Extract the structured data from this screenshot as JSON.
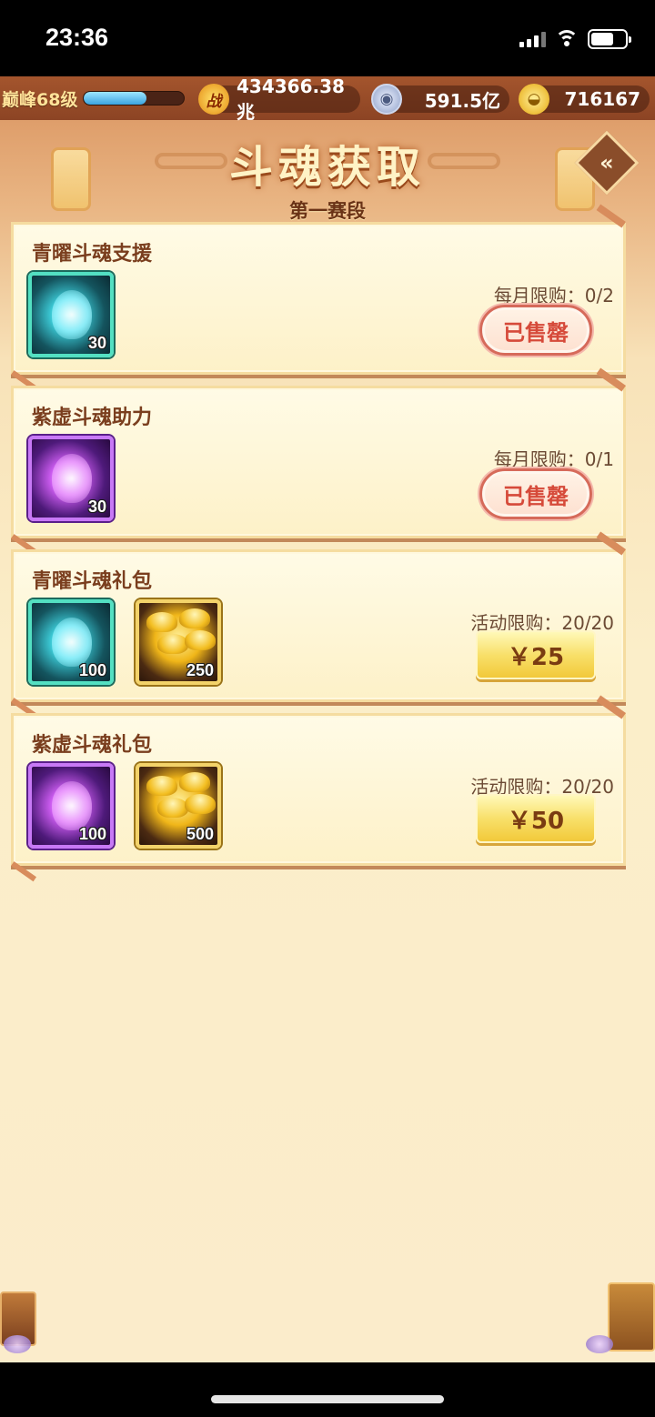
{
  "status_bar": {
    "time": "23:36"
  },
  "resources": {
    "level": "巅峰68级",
    "xp_fill": 0.62,
    "power_icon_text": "战",
    "power": "434366.38兆",
    "coins": "591.5亿",
    "ingots": "716167"
  },
  "header": {
    "title": "斗魂获取",
    "subtitle": "第一赛段",
    "back_icon": "double-chevron-left-icon"
  },
  "packs": [
    {
      "name": "青曜斗魂支援",
      "items": [
        {
          "type": "cyan-soul",
          "qty": "30"
        }
      ],
      "limit_label": "每月限购：0/2",
      "button": "已售罄",
      "sold_out": true
    },
    {
      "name": "紫虚斗魂助力",
      "items": [
        {
          "type": "purple-soul",
          "qty": "30"
        }
      ],
      "limit_label": "每月限购：0/1",
      "button": "已售罄",
      "sold_out": true
    },
    {
      "name": "青曜斗魂礼包",
      "items": [
        {
          "type": "cyan-soul",
          "qty": "100"
        },
        {
          "type": "gold-ingot",
          "qty": "250"
        }
      ],
      "limit_label": "活动限购：20/20",
      "button": "￥25",
      "sold_out": false
    },
    {
      "name": "紫虚斗魂礼包",
      "items": [
        {
          "type": "purple-soul",
          "qty": "100"
        },
        {
          "type": "gold-ingot",
          "qty": "500"
        }
      ],
      "limit_label": "活动限购：20/20",
      "button": "￥50",
      "sold_out": false
    }
  ],
  "colors": {
    "accent_gold": "#f2c93a",
    "sold_red": "#d64a3a",
    "card_bg": "#fdf1c8"
  }
}
